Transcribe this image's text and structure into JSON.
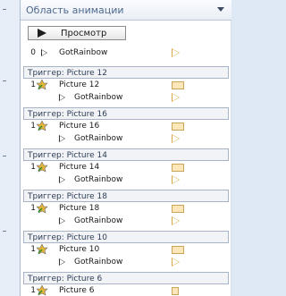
{
  "panel": {
    "title": "Область анимации",
    "play_button_label": "Просмотр"
  },
  "first_item": {
    "number": "0",
    "label": "GotRainbow"
  },
  "groups": [
    {
      "trigger": "Триггер: Picture 12",
      "number": "1",
      "object": "Picture 12",
      "effect": "GotRainbow"
    },
    {
      "trigger": "Триггер: Picture 16",
      "number": "1",
      "object": "Picture 16",
      "effect": "GotRainbow"
    },
    {
      "trigger": "Триггер: Picture 14",
      "number": "1",
      "object": "Picture 14",
      "effect": "GotRainbow"
    },
    {
      "trigger": "Триггер: Picture 18",
      "number": "1",
      "object": "Picture 18",
      "effect": "GotRainbow"
    },
    {
      "trigger": "Триггер: Picture 10",
      "number": "1",
      "object": "Picture 10",
      "effect": "GotRainbow"
    },
    {
      "trigger": "Триггер: Picture 6",
      "number": "1",
      "object": "Picture 6"
    }
  ],
  "icons": {
    "play": "play-icon",
    "custom_path": "triangle-outline-icon",
    "entrance": "star-figure-icon",
    "dropdown": "chevron-down-icon"
  },
  "colors": {
    "timing_bar": "#fde6b8",
    "emphasis_triangle": "#d8a745",
    "title_text": "#4e6a8e"
  }
}
